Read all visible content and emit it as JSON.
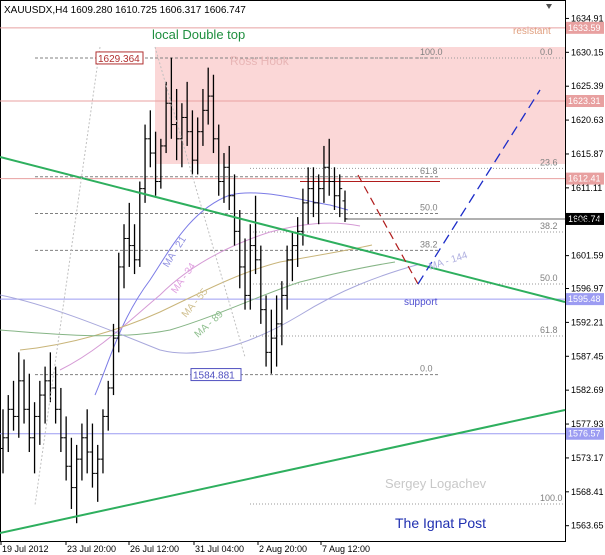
{
  "chart_data": {
    "type": "candlestick",
    "symbol_header": "XAUUSDX,H4  1609.280 1610.725 1606.317 1606.747",
    "timeframe": "H4",
    "ylim": [
      1561.5,
      1637.5
    ],
    "y_ticks": [
      1634.91,
      1630.15,
      1625.39,
      1620.63,
      1615.87,
      1611.11,
      1606.35,
      1601.59,
      1596.97,
      1592.21,
      1587.45,
      1582.69,
      1577.93,
      1573.17,
      1568.41,
      1563.65
    ],
    "x_tick_labels": [
      "19 Jul 2012",
      "23 Jul 20:00",
      "26 Jul 12:00",
      "31 Jul 04:00",
      "2 Aug 20:00",
      "7 Aug 12:00"
    ],
    "current_price_label": "1606.74",
    "price_levels": [
      {
        "label": "1633.59",
        "value": 1633.59,
        "color": "#e8a0a0",
        "style": "solid"
      },
      {
        "label": "1623.31",
        "value": 1623.31,
        "color": "#e8a0a0",
        "style": "solid"
      },
      {
        "label": "1612.41",
        "value": 1612.41,
        "color": "#e8a0a0",
        "style": "solid"
      },
      {
        "label": "1595.48",
        "value": 1595.48,
        "color": "#9c9cf2",
        "style": "solid"
      },
      {
        "label": "1576.57",
        "value": 1576.57,
        "color": "#9c9cf2",
        "style": "solid"
      }
    ],
    "fib_levels": [
      {
        "label": "100.0",
        "value": 1629.36
      },
      {
        "label": "61.8",
        "value": 1612.67
      },
      {
        "label": "50.0",
        "value": 1607.5
      },
      {
        "label": "38.2",
        "value": 1602.33
      },
      {
        "label": "0.0",
        "value": 1584.88
      }
    ],
    "fib_right_levels": [
      {
        "label": "0.0",
        "value": 1629.36
      },
      {
        "label": "23.6",
        "value": 1613.85
      },
      {
        "label": "38.2",
        "value": 1604.9
      },
      {
        "label": "50.0",
        "value": 1597.6
      },
      {
        "label": "61.8",
        "value": 1590.3
      },
      {
        "label": "100.0",
        "value": 1566.7
      }
    ],
    "price_boxes": [
      {
        "label": "1629.364",
        "value": 1629.36,
        "color": "#b03030"
      },
      {
        "label": "1584.881",
        "value": 1584.88,
        "color": "#5050c0"
      }
    ],
    "ma_labels": [
      {
        "label": "MA - 21",
        "color": "#9090e0"
      },
      {
        "label": "MA - 34",
        "color": "#e0a0e0"
      },
      {
        "label": "MA - 55",
        "color": "#d0c090"
      },
      {
        "label": "MA - 89",
        "color": "#90c090"
      },
      {
        "label": "MA - 144",
        "color": "#b0b0e0"
      }
    ],
    "annotations": {
      "local_double_top": "local Double top",
      "ross_hook": "Ross Hook",
      "resistant": "resistant",
      "support": "support",
      "watermark": "Sergey Logachev",
      "brand": "The Ignat Post"
    },
    "candles": [
      {
        "o": 1574.5,
        "h": 1580,
        "l": 1571,
        "c": 1576
      },
      {
        "o": 1576,
        "h": 1582,
        "l": 1574,
        "c": 1580
      },
      {
        "o": 1580,
        "h": 1584,
        "l": 1577,
        "c": 1579
      },
      {
        "o": 1579,
        "h": 1588,
        "l": 1576,
        "c": 1584
      },
      {
        "o": 1584,
        "h": 1587,
        "l": 1578,
        "c": 1580
      },
      {
        "o": 1580,
        "h": 1585,
        "l": 1574,
        "c": 1576
      },
      {
        "o": 1576,
        "h": 1581,
        "l": 1571,
        "c": 1579
      },
      {
        "o": 1579,
        "h": 1584,
        "l": 1575,
        "c": 1582
      },
      {
        "o": 1582,
        "h": 1586,
        "l": 1578,
        "c": 1584
      },
      {
        "o": 1584,
        "h": 1588,
        "l": 1581,
        "c": 1583
      },
      {
        "o": 1583,
        "h": 1586,
        "l": 1578,
        "c": 1580
      },
      {
        "o": 1580,
        "h": 1583,
        "l": 1574,
        "c": 1576
      },
      {
        "o": 1576,
        "h": 1579,
        "l": 1570,
        "c": 1572
      },
      {
        "o": 1572,
        "h": 1576,
        "l": 1566,
        "c": 1569
      },
      {
        "o": 1569,
        "h": 1575,
        "l": 1564,
        "c": 1573
      },
      {
        "o": 1573,
        "h": 1578,
        "l": 1570,
        "c": 1576
      },
      {
        "o": 1576,
        "h": 1580,
        "l": 1571,
        "c": 1574
      },
      {
        "o": 1574,
        "h": 1578,
        "l": 1569,
        "c": 1571
      },
      {
        "o": 1571,
        "h": 1575,
        "l": 1567,
        "c": 1573
      },
      {
        "o": 1573,
        "h": 1580,
        "l": 1571,
        "c": 1579
      },
      {
        "o": 1579,
        "h": 1584,
        "l": 1577,
        "c": 1583
      },
      {
        "o": 1583,
        "h": 1592,
        "l": 1582,
        "c": 1590
      },
      {
        "o": 1590,
        "h": 1602,
        "l": 1588,
        "c": 1600
      },
      {
        "o": 1600,
        "h": 1606,
        "l": 1597,
        "c": 1604
      },
      {
        "o": 1604,
        "h": 1609,
        "l": 1600,
        "c": 1603
      },
      {
        "o": 1603,
        "h": 1606,
        "l": 1599,
        "c": 1601
      },
      {
        "o": 1601,
        "h": 1612,
        "l": 1600,
        "c": 1611
      },
      {
        "o": 1611,
        "h": 1620,
        "l": 1609,
        "c": 1618
      },
      {
        "o": 1618,
        "h": 1622,
        "l": 1614,
        "c": 1616
      },
      {
        "o": 1616,
        "h": 1619,
        "l": 1610,
        "c": 1612
      },
      {
        "o": 1612,
        "h": 1618,
        "l": 1611,
        "c": 1617
      },
      {
        "o": 1617,
        "h": 1626,
        "l": 1616,
        "c": 1623
      },
      {
        "o": 1623,
        "h": 1629.4,
        "l": 1618,
        "c": 1620
      },
      {
        "o": 1620,
        "h": 1625,
        "l": 1615,
        "c": 1618
      },
      {
        "o": 1618,
        "h": 1623,
        "l": 1614,
        "c": 1621
      },
      {
        "o": 1621,
        "h": 1626,
        "l": 1617,
        "c": 1619
      },
      {
        "o": 1619,
        "h": 1622,
        "l": 1613,
        "c": 1615
      },
      {
        "o": 1615,
        "h": 1621,
        "l": 1613,
        "c": 1619
      },
      {
        "o": 1619,
        "h": 1625,
        "l": 1617,
        "c": 1622
      },
      {
        "o": 1622,
        "h": 1628,
        "l": 1620,
        "c": 1624
      },
      {
        "o": 1624,
        "h": 1627,
        "l": 1616,
        "c": 1618
      },
      {
        "o": 1618,
        "h": 1620,
        "l": 1610,
        "c": 1612
      },
      {
        "o": 1612,
        "h": 1616,
        "l": 1609,
        "c": 1614
      },
      {
        "o": 1614,
        "h": 1617,
        "l": 1608,
        "c": 1610
      },
      {
        "o": 1610,
        "h": 1613,
        "l": 1603,
        "c": 1605
      },
      {
        "o": 1605,
        "h": 1608,
        "l": 1597,
        "c": 1600
      },
      {
        "o": 1600,
        "h": 1604,
        "l": 1594,
        "c": 1596
      },
      {
        "o": 1596,
        "h": 1606,
        "l": 1594,
        "c": 1603
      },
      {
        "o": 1603,
        "h": 1610,
        "l": 1599,
        "c": 1601
      },
      {
        "o": 1601,
        "h": 1603,
        "l": 1592,
        "c": 1594
      },
      {
        "o": 1594,
        "h": 1596,
        "l": 1586,
        "c": 1588
      },
      {
        "o": 1588,
        "h": 1594,
        "l": 1585,
        "c": 1590
      },
      {
        "o": 1590,
        "h": 1596,
        "l": 1586,
        "c": 1592
      },
      {
        "o": 1592,
        "h": 1598,
        "l": 1589,
        "c": 1596
      },
      {
        "o": 1596,
        "h": 1603,
        "l": 1594,
        "c": 1601
      },
      {
        "o": 1601,
        "h": 1605,
        "l": 1598,
        "c": 1603
      },
      {
        "o": 1603,
        "h": 1607,
        "l": 1600,
        "c": 1605
      },
      {
        "o": 1605,
        "h": 1611,
        "l": 1603,
        "c": 1609
      },
      {
        "o": 1609,
        "h": 1614,
        "l": 1606,
        "c": 1611
      },
      {
        "o": 1611,
        "h": 1614,
        "l": 1607,
        "c": 1609
      },
      {
        "o": 1609,
        "h": 1613,
        "l": 1606,
        "c": 1611
      },
      {
        "o": 1611,
        "h": 1617,
        "l": 1609,
        "c": 1614
      },
      {
        "o": 1614,
        "h": 1618,
        "l": 1610,
        "c": 1612
      },
      {
        "o": 1612,
        "h": 1614,
        "l": 1608,
        "c": 1610
      },
      {
        "o": 1610,
        "h": 1613,
        "l": 1607,
        "c": 1611
      },
      {
        "o": 1609.28,
        "h": 1610.73,
        "l": 1606.32,
        "c": 1606.75
      }
    ]
  }
}
